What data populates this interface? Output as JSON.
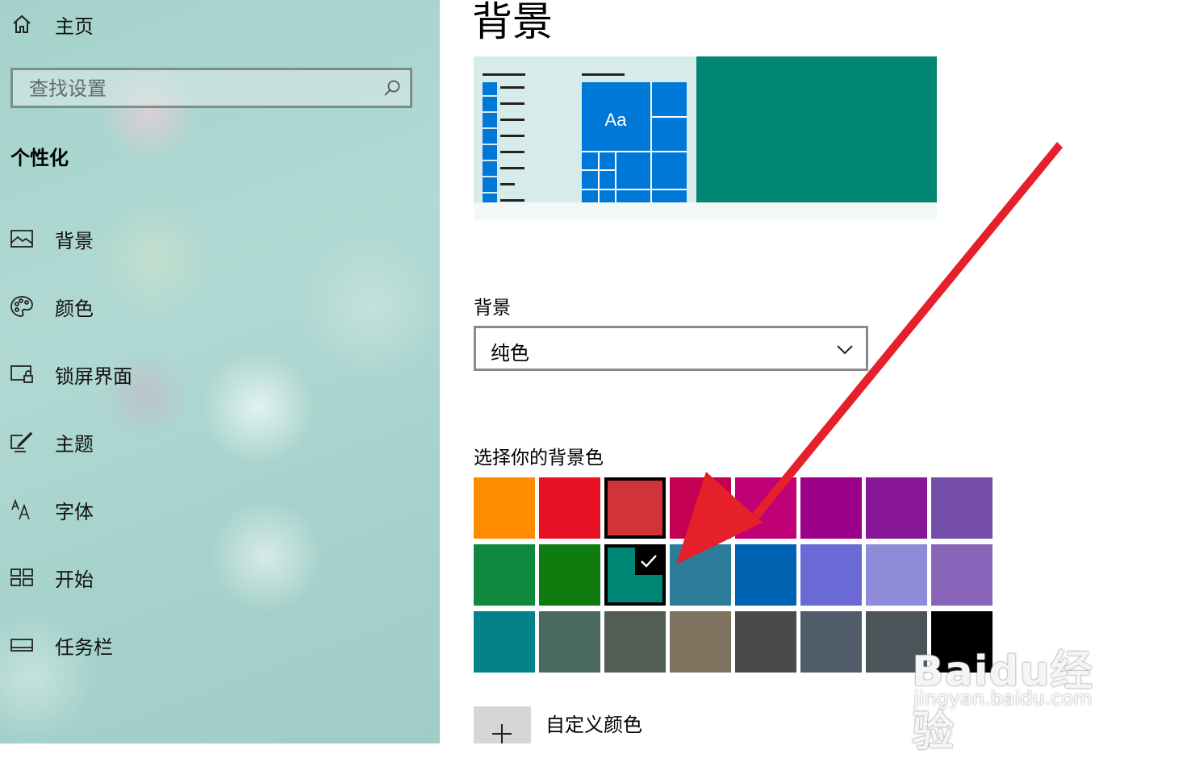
{
  "sidebar": {
    "home_label": "主页",
    "search_placeholder": "查找设置",
    "section_title": "个性化",
    "items": [
      {
        "label": "背景",
        "icon": "picture-icon"
      },
      {
        "label": "颜色",
        "icon": "palette-icon"
      },
      {
        "label": "锁屏界面",
        "icon": "lock-screen-icon"
      },
      {
        "label": "主题",
        "icon": "theme-icon"
      },
      {
        "label": "字体",
        "icon": "font-icon"
      },
      {
        "label": "开始",
        "icon": "start-icon"
      },
      {
        "label": "任务栏",
        "icon": "taskbar-icon"
      }
    ]
  },
  "main": {
    "page_title": "背景",
    "preview": {
      "tile_text": "Aa",
      "accent_color": "#0078d7",
      "background_color": "#008672"
    },
    "background_dropdown": {
      "label": "背景",
      "selected": "纯色"
    },
    "color_picker": {
      "label": "选择你的背景色",
      "rows": [
        [
          "#ff8c00",
          "#e81123",
          "#d13438",
          "#c30052",
          "#bf0077",
          "#9a0089",
          "#881798",
          "#744da9"
        ],
        [
          "#10893e",
          "#107c10",
          "#018574",
          "#2d7d9a",
          "#0063b1",
          "#6b69d6",
          "#8e8cd8",
          "#8764b8"
        ],
        [
          "#038387",
          "#486860",
          "#525e54",
          "#7e735f",
          "#4c4a48",
          "#515c6b",
          "#4a5459",
          "#000000"
        ]
      ],
      "selected_border": {
        "row": 0,
        "col": 2
      },
      "checked": {
        "row": 1,
        "col": 2
      }
    },
    "custom_color_label": "自定义颜色"
  },
  "annotation": {
    "arrow_color": "#e5202a"
  },
  "watermark": {
    "brand": "Baidu经验",
    "url": "jingyan.baidu.com"
  }
}
